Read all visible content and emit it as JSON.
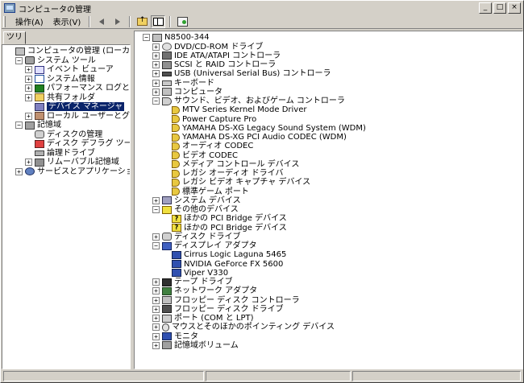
{
  "window": {
    "title": "コンピュータの管理"
  },
  "titlebar_buttons": {
    "minimize": "_",
    "maximize": "□",
    "close": "×"
  },
  "menu": {
    "items": [
      "操作(A)",
      "表示(V)"
    ]
  },
  "toolbar": {
    "icons": [
      "back-arrow-icon",
      "forward-arrow-icon",
      "up-folder-icon",
      "show-hide-tree-icon",
      "properties-icon"
    ]
  },
  "left": {
    "tab_label": "ツリー",
    "tree": [
      {
        "label": "コンピュータの管理 (ローカル)",
        "level": 0,
        "expander": "",
        "icon": "computer"
      },
      {
        "label": "システム ツール",
        "level": 1,
        "expander": "−",
        "icon": "tools"
      },
      {
        "label": "イベント ビューア",
        "level": 2,
        "expander": "+",
        "icon": "event"
      },
      {
        "label": "システム情報",
        "level": 2,
        "expander": "+",
        "icon": "info"
      },
      {
        "label": "パフォーマンス ログと警告",
        "level": 2,
        "expander": "+",
        "icon": "perf"
      },
      {
        "label": "共有フォルダ",
        "level": 2,
        "expander": "+",
        "icon": "folder"
      },
      {
        "label": "デバイス マネージャ",
        "level": 2,
        "expander": "",
        "icon": "device",
        "selected": true
      },
      {
        "label": "ローカル ユーザーとグループ",
        "level": 2,
        "expander": "+",
        "icon": "users"
      },
      {
        "label": "記憶域",
        "level": 1,
        "expander": "−",
        "icon": "storage"
      },
      {
        "label": "ディスクの管理",
        "level": 2,
        "expander": "",
        "icon": "disk"
      },
      {
        "label": "ディスク デフラグ ツール",
        "level": 2,
        "expander": "",
        "icon": "defrag"
      },
      {
        "label": "論理ドライブ",
        "level": 2,
        "expander": "",
        "icon": "drive"
      },
      {
        "label": "リムーバブル記憶域",
        "level": 2,
        "expander": "+",
        "icon": "removable"
      },
      {
        "label": "サービスとアプリケーション",
        "level": 1,
        "expander": "+",
        "icon": "services"
      }
    ]
  },
  "right": {
    "tree": [
      {
        "label": "N8500-344",
        "level": 0,
        "expander": "−",
        "icon": "computer"
      },
      {
        "label": "DVD/CD-ROM ドライブ",
        "level": 1,
        "expander": "+",
        "icon": "cdrom"
      },
      {
        "label": "IDE ATA/ATAPI コントローラ",
        "level": 1,
        "expander": "+",
        "icon": "ide"
      },
      {
        "label": "SCSI と RAID コントローラ",
        "level": 1,
        "expander": "+",
        "icon": "scsi"
      },
      {
        "label": "USB (Universal Serial Bus) コントローラ",
        "level": 1,
        "expander": "+",
        "icon": "usb"
      },
      {
        "label": "キーボード",
        "level": 1,
        "expander": "+",
        "icon": "kbd"
      },
      {
        "label": "コンピュータ",
        "level": 1,
        "expander": "+",
        "icon": "computer"
      },
      {
        "label": "サウンド、ビデオ、およびゲーム コントローラ",
        "level": 1,
        "expander": "−",
        "icon": "sound"
      },
      {
        "label": "MTV Series Kernel Mode Driver",
        "level": 2,
        "expander": "",
        "icon": "speaker"
      },
      {
        "label": "Power Capture Pro",
        "level": 2,
        "expander": "",
        "icon": "speaker"
      },
      {
        "label": "YAMAHA DS-XG Legacy Sound System (WDM)",
        "level": 2,
        "expander": "",
        "icon": "speaker"
      },
      {
        "label": "YAMAHA DS-XG PCI Audio CODEC (WDM)",
        "level": 2,
        "expander": "",
        "icon": "speaker"
      },
      {
        "label": "オーディオ CODEC",
        "level": 2,
        "expander": "",
        "icon": "speaker"
      },
      {
        "label": "ビデオ CODEC",
        "level": 2,
        "expander": "",
        "icon": "speaker"
      },
      {
        "label": "メディア コントロール デバイス",
        "level": 2,
        "expander": "",
        "icon": "speaker"
      },
      {
        "label": "レガシ オーディオ ドライバ",
        "level": 2,
        "expander": "",
        "icon": "speaker"
      },
      {
        "label": "レガシ ビデオ キャプチャ デバイス",
        "level": 2,
        "expander": "",
        "icon": "speaker"
      },
      {
        "label": "標準ゲーム ポート",
        "level": 2,
        "expander": "",
        "icon": "gameport"
      },
      {
        "label": "システム デバイス",
        "level": 1,
        "expander": "+",
        "icon": "sys"
      },
      {
        "label": "その他のデバイス",
        "level": 1,
        "expander": "−",
        "icon": "other"
      },
      {
        "label": "ほかの PCI Bridge デバイス",
        "level": 2,
        "expander": "",
        "icon": "q"
      },
      {
        "label": "ほかの PCI Bridge デバイス",
        "level": 2,
        "expander": "",
        "icon": "q"
      },
      {
        "label": "ディスク ドライブ",
        "level": 1,
        "expander": "+",
        "icon": "disk"
      },
      {
        "label": "ディスプレイ アダプタ",
        "level": 1,
        "expander": "−",
        "icon": "display"
      },
      {
        "label": "Cirrus Logic Laguna 5465",
        "level": 2,
        "expander": "",
        "icon": "monitor"
      },
      {
        "label": "NVIDIA GeForce FX 5600",
        "level": 2,
        "expander": "",
        "icon": "monitor"
      },
      {
        "label": "Viper V330",
        "level": 2,
        "expander": "",
        "icon": "monitor"
      },
      {
        "label": "テープ ドライブ",
        "level": 1,
        "expander": "+",
        "icon": "tape"
      },
      {
        "label": "ネットワーク アダプタ",
        "level": 1,
        "expander": "+",
        "icon": "net"
      },
      {
        "label": "フロッピー ディスク コントローラ",
        "level": 1,
        "expander": "+",
        "icon": "floppyc"
      },
      {
        "label": "フロッピー ディスク ドライブ",
        "level": 1,
        "expander": "+",
        "icon": "floppy"
      },
      {
        "label": "ポート (COM と LPT)",
        "level": 1,
        "expander": "+",
        "icon": "port"
      },
      {
        "label": "マウスとそのほかのポインティング デバイス",
        "level": 1,
        "expander": "+",
        "icon": "mouse"
      },
      {
        "label": "モニタ",
        "level": 1,
        "expander": "+",
        "icon": "monitor"
      },
      {
        "label": "記憶域ボリューム",
        "level": 1,
        "expander": "+",
        "icon": "vol"
      }
    ]
  },
  "statusbar": {
    "cells": [
      "",
      "",
      ""
    ]
  }
}
